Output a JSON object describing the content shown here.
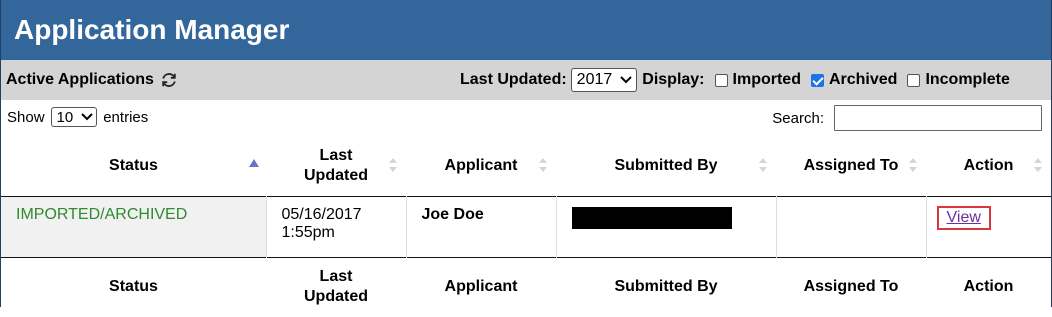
{
  "app": {
    "title": "Application Manager"
  },
  "toolbar": {
    "active_label": "Active Applications",
    "refresh_icon": "refresh-icon",
    "last_updated_label": "Last Updated:",
    "year_value": "2017",
    "display_label": "Display:",
    "filters": [
      {
        "label": "Imported",
        "checked": false
      },
      {
        "label": "Archived",
        "checked": true
      },
      {
        "label": "Incomplete",
        "checked": false
      }
    ]
  },
  "controls": {
    "show_label": "Show",
    "entries_value": "10",
    "entries_label": "entries",
    "search_label": "Search:",
    "search_value": ""
  },
  "table": {
    "columns": [
      "Status",
      "Last Updated",
      "Applicant",
      "Submitted By",
      "Assigned To",
      "Action"
    ],
    "rows": [
      {
        "status": "IMPORTED/ARCHIVED",
        "last_updated_date": "05/16/2017",
        "last_updated_time": "1:55pm",
        "applicant": "Joe Doe",
        "submitted_by": "",
        "assigned_to": "",
        "action": "View"
      }
    ]
  },
  "colors": {
    "title_bar": "#33669a",
    "toolbar_bg": "#d4d4d4",
    "status_text": "#2e8b2e",
    "link": "#6b2fa0",
    "highlight_box": "#d9363e"
  }
}
